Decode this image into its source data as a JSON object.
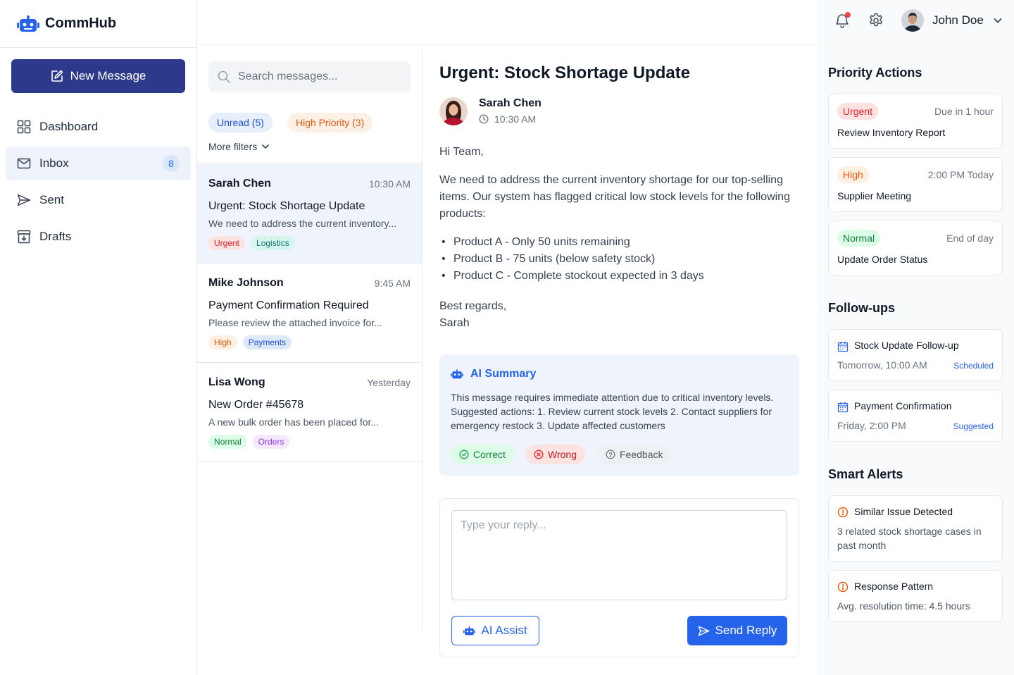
{
  "app": {
    "name": "CommHub"
  },
  "sidebar": {
    "new_message": "New Message",
    "items": [
      {
        "label": "Dashboard",
        "icon": "dashboard-icon"
      },
      {
        "label": "Inbox",
        "icon": "mail-icon",
        "badge": "8",
        "active": true
      },
      {
        "label": "Sent",
        "icon": "send-icon"
      },
      {
        "label": "Drafts",
        "icon": "archive-icon"
      }
    ]
  },
  "search": {
    "placeholder": "Search messages..."
  },
  "filters": {
    "unread": "Unread (5)",
    "high_priority": "High Priority (3)",
    "more": "More filters"
  },
  "messages": [
    {
      "sender": "Sarah Chen",
      "time": "10:30 AM",
      "subject": "Urgent: Stock Shortage Update",
      "preview": "We need to address the current inventory...",
      "tags": [
        "Urgent",
        "Logistics"
      ]
    },
    {
      "sender": "Mike Johnson",
      "time": "9:45 AM",
      "subject": "Payment Confirmation Required",
      "preview": "Please review the attached invoice for...",
      "tags": [
        "High",
        "Payments"
      ]
    },
    {
      "sender": "Lisa Wong",
      "time": "Yesterday",
      "subject": "New Order #45678",
      "preview": "A new bulk order has been placed for...",
      "tags": [
        "Normal",
        "Orders"
      ]
    }
  ],
  "reader": {
    "title": "Urgent: Stock Shortage Update",
    "sender": "Sarah Chen",
    "time": "10:30 AM",
    "greeting": "Hi Team,",
    "paragraph": "We need to address the current inventory shortage for our top-selling items. Our system has flagged critical low stock levels for the following products:",
    "bullets": [
      "Product A - Only 50 units remaining",
      "Product B - 75 units (below safety stock)",
      "Product C - Complete stockout expected in 3 days"
    ],
    "signoff": "Best regards,",
    "signature": "Sarah"
  },
  "ai_summary": {
    "title": "AI Summary",
    "text": "This message requires immediate attention due to critical inventory levels. Suggested actions: 1. Review current stock levels 2. Contact suppliers for emergency restock 3. Update affected customers",
    "correct": "Correct",
    "wrong": "Wrong",
    "feedback": "Feedback"
  },
  "reply": {
    "placeholder": "Type your reply...",
    "ai_assist": "AI Assist",
    "send": "Send Reply"
  },
  "user": {
    "name": "John Doe"
  },
  "priority_actions": {
    "title": "Priority Actions",
    "items": [
      {
        "level": "Urgent",
        "due": "Due in 1 hour",
        "task": "Review Inventory Report"
      },
      {
        "level": "High",
        "due": "2:00 PM Today",
        "task": "Supplier Meeting"
      },
      {
        "level": "Normal",
        "due": "End of day",
        "task": "Update Order Status"
      }
    ]
  },
  "followups": {
    "title": "Follow-ups",
    "items": [
      {
        "title": "Stock Update Follow-up",
        "time": "Tomorrow, 10:00 AM",
        "status": "Scheduled"
      },
      {
        "title": "Payment Confirmation",
        "time": "Friday, 2:00 PM",
        "status": "Suggested"
      }
    ]
  },
  "smart_alerts": {
    "title": "Smart Alerts",
    "items": [
      {
        "title": "Similar Issue Detected",
        "text": "3 related stock shortage cases in past month"
      },
      {
        "title": "Response Pattern",
        "text": "Avg. resolution time: 4.5 hours"
      }
    ]
  },
  "colors": {
    "primary": "#2563eb",
    "new_message_bg": "#2d3a8c",
    "urgent": "#dc2626",
    "high": "#ea580c",
    "normal": "#16a34a"
  }
}
